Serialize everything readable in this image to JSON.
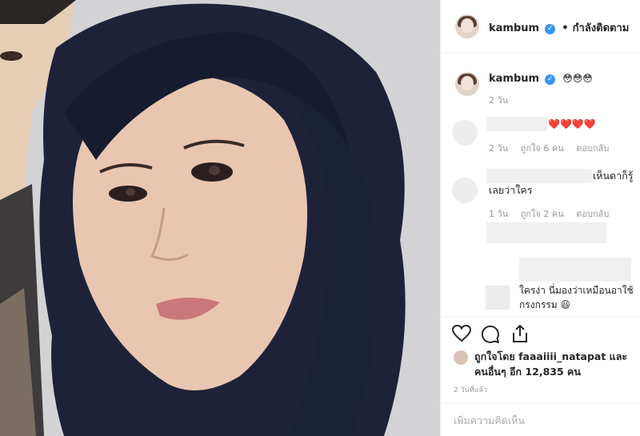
{
  "header": {
    "username": "kambum",
    "separator": "•",
    "follow_status": "กำลังติดตาม"
  },
  "caption": {
    "username": "kambum",
    "text": "😳😳😳",
    "time": "2 วัน"
  },
  "comments": [
    {
      "text": "❤️❤️❤️❤️",
      "time": "2 วัน",
      "likes": "ถูกใจ 6 คน",
      "reply": "ตอบกลับ"
    },
    {
      "text_line1": "เห็นดาก็รู้",
      "text_line2": "เลยว่าใคร",
      "time": "1 วัน",
      "likes": "ถูกใจ 2 คน",
      "reply": "ตอบกลับ"
    },
    {
      "text_line1": "ใครง่า นี่มองว่าเหมือนอาใช้",
      "text_line2": "กรงกรรม 😆"
    }
  ],
  "actions": {
    "like_icon": "heart-icon",
    "comment_icon": "comment-icon",
    "share_icon": "share-icon"
  },
  "likes": {
    "line1": "ถูกใจโดย faaaiiii_natapat และ",
    "line2": "คนอื่นๆ อีก 12,835 คน"
  },
  "timestamp": "2 วันที่แล้ว",
  "add_comment": {
    "placeholder": "เพิ่มความคิดเห็น"
  },
  "colors": {
    "verified": "#3897f0",
    "text": "#262626",
    "muted": "#999999"
  }
}
